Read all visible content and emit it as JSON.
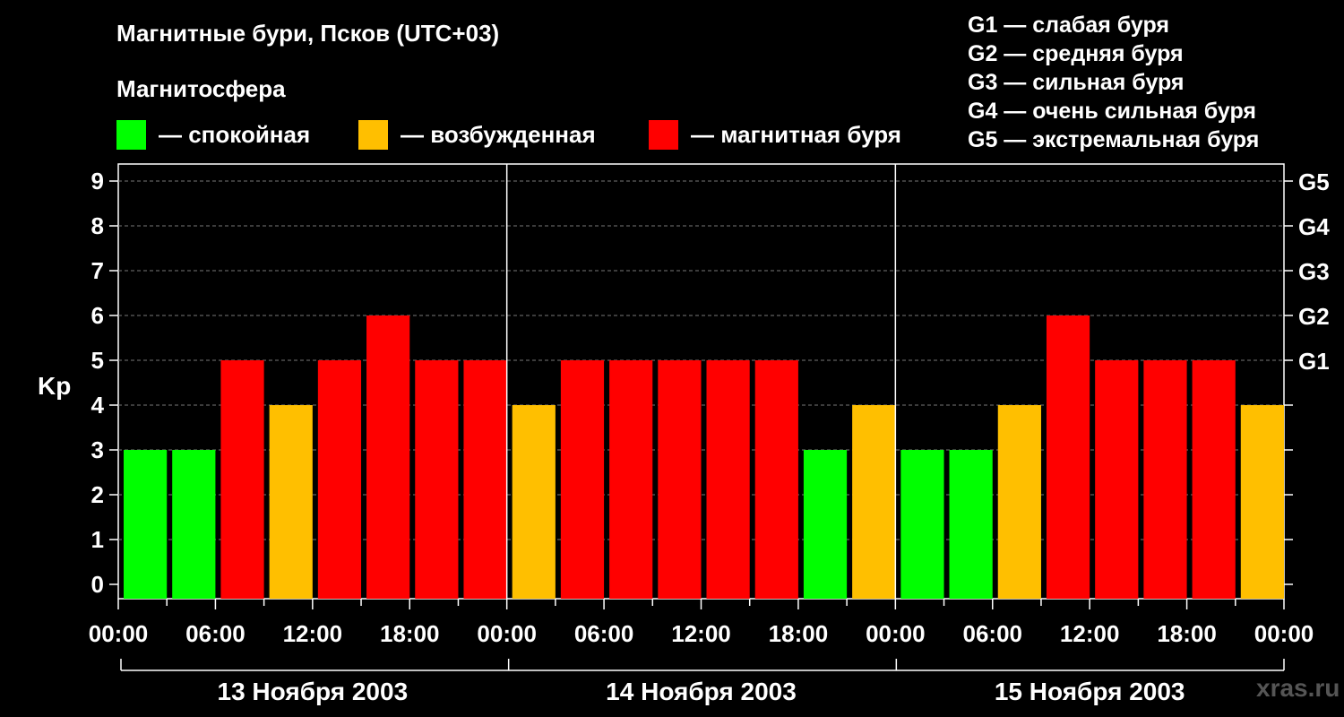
{
  "header": {
    "title": "Магнитные бури, Псков (UTC+03)",
    "subtitle": "Магнитосфера"
  },
  "legend": [
    {
      "label": "— спокойная",
      "color": "#00ff00"
    },
    {
      "label": "— возбужденная",
      "color": "#ffbf00"
    },
    {
      "label": "— магнитная буря",
      "color": "#ff0000"
    }
  ],
  "g_levels": [
    "G1 — слабая буря",
    "G2 — средняя буря",
    "G3 — сильная буря",
    "G4 — очень сильная буря",
    "G5 — экстремальная буря"
  ],
  "watermark": "xras.ru",
  "chart_data": {
    "type": "bar",
    "ylabel": "Kp",
    "ylim": [
      0,
      9
    ],
    "yticks": [
      "0",
      "1",
      "2",
      "3",
      "4",
      "5",
      "6",
      "7",
      "8",
      "9"
    ],
    "right_ticks": [
      {
        "value": 5,
        "label": "G1"
      },
      {
        "value": 6,
        "label": "G2"
      },
      {
        "value": 7,
        "label": "G3"
      },
      {
        "value": 8,
        "label": "G4"
      },
      {
        "value": 9,
        "label": "G5"
      }
    ],
    "xticks": [
      "00:00",
      "06:00",
      "12:00",
      "18:00",
      "00:00",
      "06:00",
      "12:00",
      "18:00",
      "00:00",
      "06:00",
      "12:00",
      "18:00",
      "00:00"
    ],
    "days": [
      "13 Ноября 2003",
      "14 Ноября 2003",
      "15 Ноября 2003"
    ],
    "values": [
      3,
      3,
      5,
      4,
      5,
      6,
      5,
      5,
      4,
      5,
      5,
      5,
      5,
      5,
      3,
      4,
      3,
      3,
      4,
      6,
      5,
      5,
      5,
      4
    ],
    "colors": {
      "quiet": "#00ff00",
      "active": "#ffbf00",
      "storm": "#ff0000"
    },
    "grid": true
  }
}
